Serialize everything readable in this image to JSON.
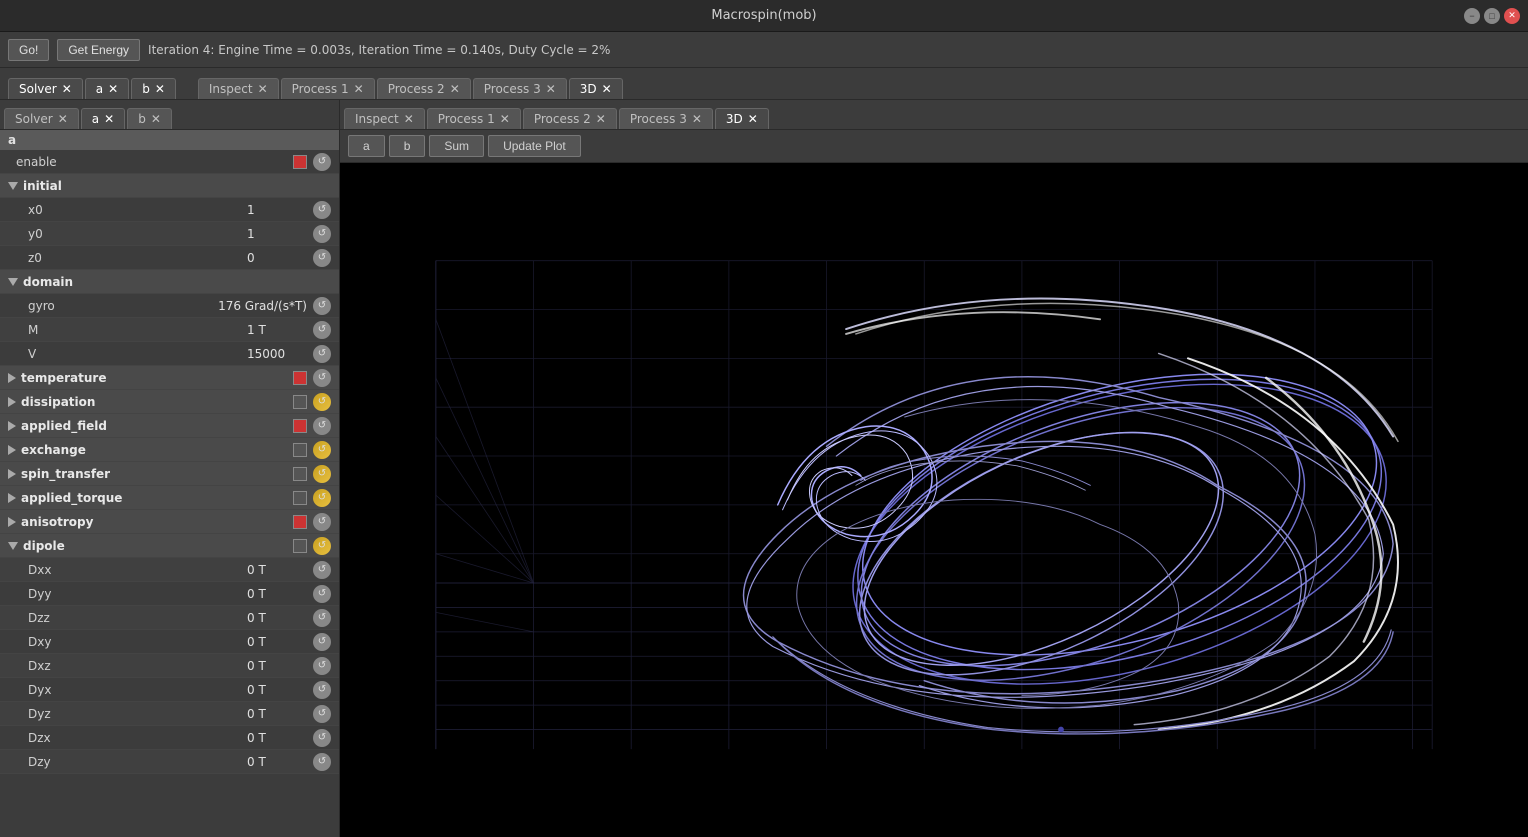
{
  "window": {
    "title": "Macrospin(mob)"
  },
  "toolbar": {
    "go_label": "Go!",
    "get_energy_label": "Get Energy",
    "status": "Iteration 4: Engine Time = 0.003s, Iteration Time = 0.140s, Duty Cycle = 2%"
  },
  "top_tabs": [
    {
      "label": "Solver",
      "closeable": true,
      "active": false
    },
    {
      "label": "a",
      "closeable": true,
      "active": false
    },
    {
      "label": "b",
      "closeable": true,
      "active": false
    },
    {
      "label": "Inspect",
      "closeable": true,
      "active": false
    },
    {
      "label": "Process 1",
      "closeable": true,
      "active": false
    },
    {
      "label": "Process 2",
      "closeable": true,
      "active": false
    },
    {
      "label": "Process 3",
      "closeable": true,
      "active": false
    },
    {
      "label": "3D",
      "closeable": true,
      "active": true
    }
  ],
  "left_tabs": [
    {
      "label": "Solver",
      "closeable": true,
      "active": false
    },
    {
      "label": "a",
      "closeable": true,
      "active": true
    },
    {
      "label": "b",
      "closeable": true,
      "active": false
    }
  ],
  "panel_title": "a",
  "properties": {
    "section": "a",
    "items": [
      {
        "type": "row",
        "label": "enable",
        "value": "",
        "checkbox": true,
        "checked": true,
        "has_reset": true,
        "reset_gold": false
      },
      {
        "type": "group",
        "label": "initial",
        "expanded": true,
        "has_reset": false
      },
      {
        "type": "row",
        "label": "x0",
        "value": "1",
        "checkbox": false,
        "checked": false,
        "has_reset": true,
        "reset_gold": false,
        "indent": 2
      },
      {
        "type": "row",
        "label": "y0",
        "value": "1",
        "checkbox": false,
        "checked": false,
        "has_reset": true,
        "reset_gold": false,
        "indent": 2
      },
      {
        "type": "row",
        "label": "z0",
        "value": "0",
        "checkbox": false,
        "checked": false,
        "has_reset": true,
        "reset_gold": false,
        "indent": 2
      },
      {
        "type": "group",
        "label": "domain",
        "expanded": true,
        "has_reset": false
      },
      {
        "type": "row",
        "label": "gyro",
        "value": "176 Grad/(s*T)",
        "checkbox": false,
        "checked": false,
        "has_reset": true,
        "reset_gold": false,
        "indent": 2
      },
      {
        "type": "row",
        "label": "M",
        "value": "1 T",
        "checkbox": false,
        "checked": false,
        "has_reset": true,
        "reset_gold": false,
        "indent": 2
      },
      {
        "type": "row",
        "label": "V",
        "value": "15000",
        "checkbox": false,
        "checked": false,
        "has_reset": true,
        "reset_gold": false,
        "indent": 2
      },
      {
        "type": "group",
        "label": "temperature",
        "expanded": false,
        "has_checkbox": true,
        "checked": true,
        "has_reset": true,
        "reset_gold": false
      },
      {
        "type": "group",
        "label": "dissipation",
        "expanded": false,
        "has_checkbox": true,
        "checked": false,
        "has_reset": true,
        "reset_gold": true
      },
      {
        "type": "group",
        "label": "applied_field",
        "expanded": false,
        "has_checkbox": true,
        "checked": true,
        "has_reset": true,
        "reset_gold": false
      },
      {
        "type": "group",
        "label": "exchange",
        "expanded": false,
        "has_checkbox": true,
        "checked": false,
        "has_reset": true,
        "reset_gold": true
      },
      {
        "type": "group",
        "label": "spin_transfer",
        "expanded": false,
        "has_checkbox": true,
        "checked": false,
        "has_reset": true,
        "reset_gold": true
      },
      {
        "type": "group",
        "label": "applied_torque",
        "expanded": false,
        "has_checkbox": true,
        "checked": false,
        "has_reset": true,
        "reset_gold": true
      },
      {
        "type": "group",
        "label": "anisotropy",
        "expanded": false,
        "has_checkbox": true,
        "checked": true,
        "has_reset": true,
        "reset_gold": false
      },
      {
        "type": "group",
        "label": "dipole",
        "expanded": true,
        "has_checkbox": true,
        "checked": false,
        "has_reset": true,
        "reset_gold": true
      },
      {
        "type": "row",
        "label": "Dxx",
        "value": "0 T",
        "checkbox": false,
        "checked": false,
        "has_reset": true,
        "reset_gold": false,
        "indent": 2
      },
      {
        "type": "row",
        "label": "Dyy",
        "value": "0 T",
        "checkbox": false,
        "checked": false,
        "has_reset": true,
        "reset_gold": false,
        "indent": 2
      },
      {
        "type": "row",
        "label": "Dzz",
        "value": "0 T",
        "checkbox": false,
        "checked": false,
        "has_reset": true,
        "reset_gold": false,
        "indent": 2
      },
      {
        "type": "row",
        "label": "Dxy",
        "value": "0 T",
        "checkbox": false,
        "checked": false,
        "has_reset": true,
        "reset_gold": false,
        "indent": 2
      },
      {
        "type": "row",
        "label": "Dxz",
        "value": "0 T",
        "checkbox": false,
        "checked": false,
        "has_reset": true,
        "reset_gold": false,
        "indent": 2
      },
      {
        "type": "row",
        "label": "Dyx",
        "value": "0 T",
        "checkbox": false,
        "checked": false,
        "has_reset": true,
        "reset_gold": false,
        "indent": 2
      },
      {
        "type": "row",
        "label": "Dyz",
        "value": "0 T",
        "checkbox": false,
        "checked": false,
        "has_reset": true,
        "reset_gold": false,
        "indent": 2
      },
      {
        "type": "row",
        "label": "Dzx",
        "value": "0 T",
        "checkbox": false,
        "checked": false,
        "has_reset": true,
        "reset_gold": false,
        "indent": 2
      },
      {
        "type": "row",
        "label": "Dzy",
        "value": "0 T",
        "checkbox": false,
        "checked": false,
        "has_reset": true,
        "reset_gold": false,
        "indent": 2
      }
    ]
  },
  "inner_tabs": [
    {
      "label": "Inspect",
      "closeable": true,
      "active": false
    },
    {
      "label": "Process 1",
      "closeable": true,
      "active": false
    },
    {
      "label": "Process 2",
      "closeable": true,
      "active": false
    },
    {
      "label": "Process 3",
      "closeable": true,
      "active": false
    },
    {
      "label": "3D",
      "closeable": true,
      "active": true
    }
  ],
  "plot_controls": {
    "a_label": "a",
    "b_label": "b",
    "sum_label": "Sum",
    "update_plot_label": "Update Plot"
  },
  "colors": {
    "background": "#000000",
    "grid": "#404060",
    "curve": "#8888ff",
    "curve_bright": "#ffffff",
    "accent": "#cc3333"
  }
}
